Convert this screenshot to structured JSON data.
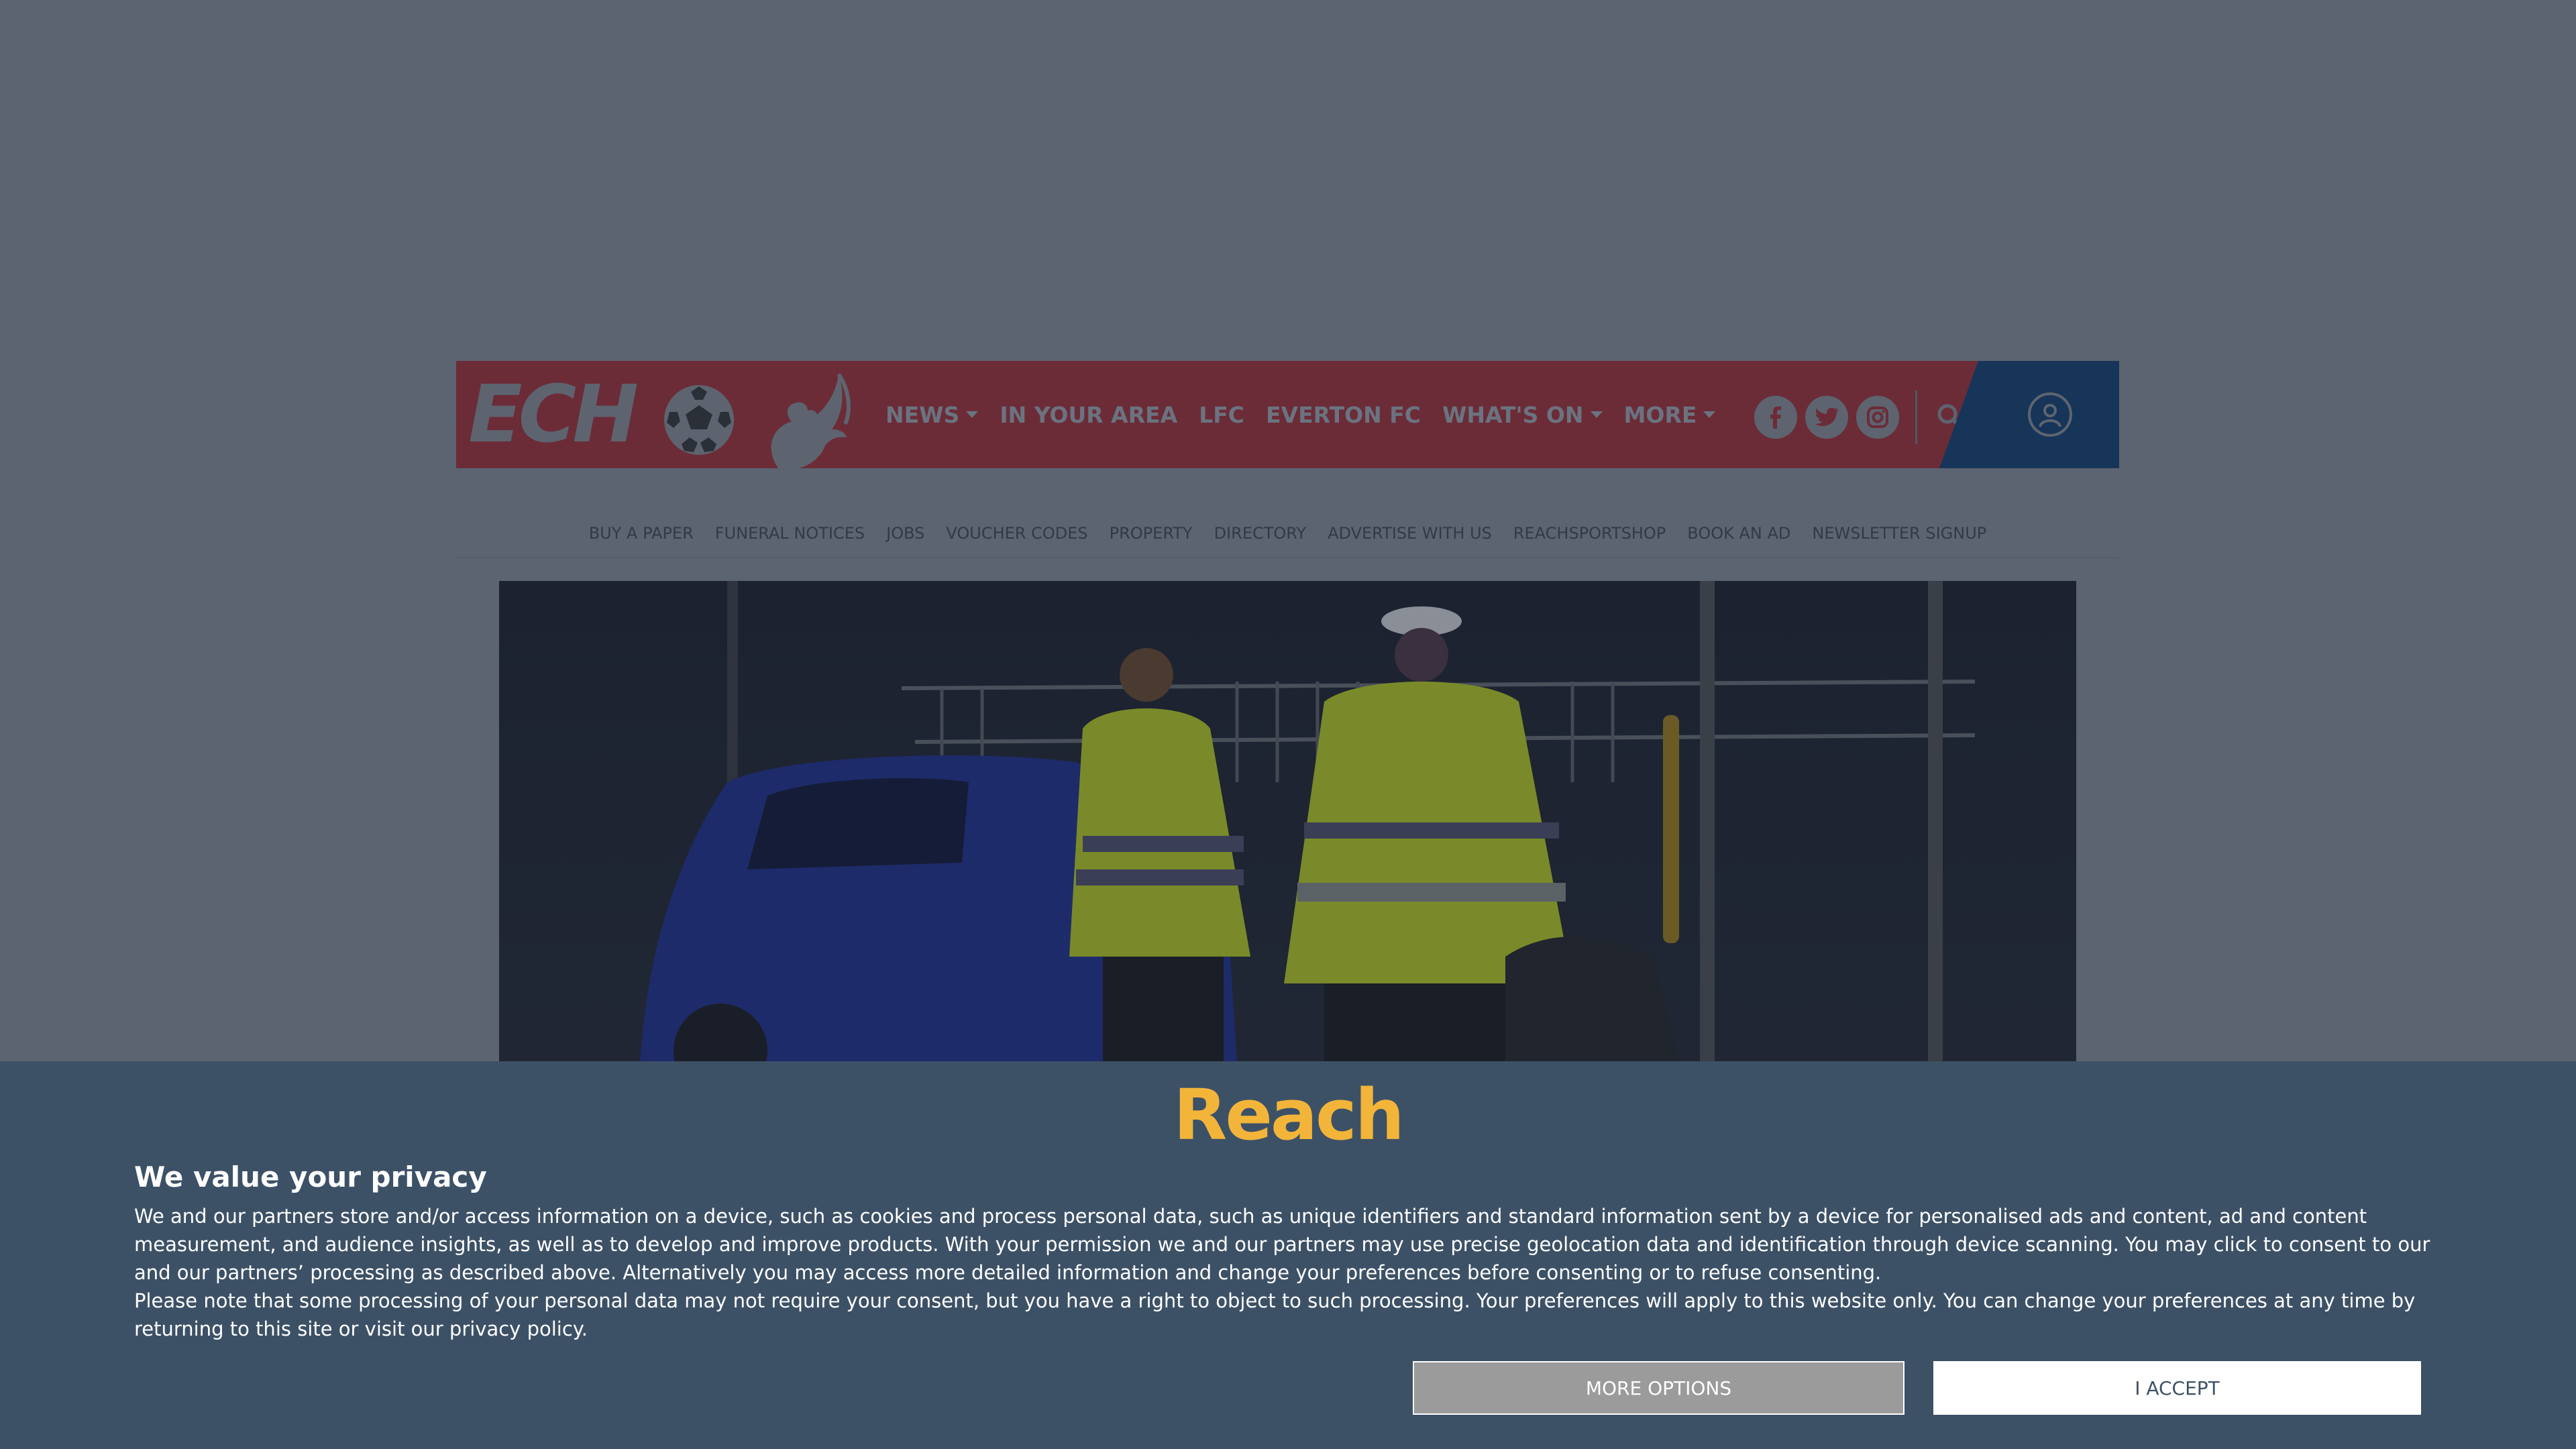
{
  "site": {
    "logo_text": "ECHO",
    "main_nav": [
      {
        "label": "NEWS",
        "has_dropdown": true
      },
      {
        "label": "IN YOUR AREA",
        "has_dropdown": false
      },
      {
        "label": "LFC",
        "has_dropdown": false
      },
      {
        "label": "EVERTON FC",
        "has_dropdown": false
      },
      {
        "label": "WHAT'S ON",
        "has_dropdown": true
      },
      {
        "label": "MORE",
        "has_dropdown": true
      }
    ],
    "social_icons": [
      "facebook-icon",
      "twitter-icon",
      "instagram-icon"
    ],
    "sub_nav": [
      "BUY A PAPER",
      "FUNERAL NOTICES",
      "JOBS",
      "VOUCHER CODES",
      "PROPERTY",
      "DIRECTORY",
      "ADVERTISE WITH US",
      "REACHSPORTSHOP",
      "BOOK AN AD",
      "NEWSLETTER SIGNUP"
    ]
  },
  "consent": {
    "brand": "Reach",
    "title": "We value your privacy",
    "paragraph_1": "We and our partners store and/or access information on a device, such as cookies and process personal data, such as unique identifiers and standard information sent by a device for personalised ads and content, ad and content measurement, and audience insights, as well as to develop and improve products. With your permission we and our partners may use precise geolocation data and identification through device scanning. You may click to consent to our and our partners’ processing as described above. Alternatively you may access more detailed information and change your preferences before consenting or to refuse consenting.",
    "paragraph_2": "Please note that some processing of your personal data may not require your consent, but you have a right to object to such processing. Your preferences will apply to this website only. You can change your preferences at any time by returning to this site or visit our privacy policy.",
    "more_options_label": "MORE OPTIONS",
    "accept_label": "I ACCEPT"
  },
  "colors": {
    "overlay": "#5b6470",
    "masthead": "#6b2c38",
    "account_slab": "#173559",
    "banner": "#3d5166",
    "brand_accent": "#f2b53a"
  }
}
